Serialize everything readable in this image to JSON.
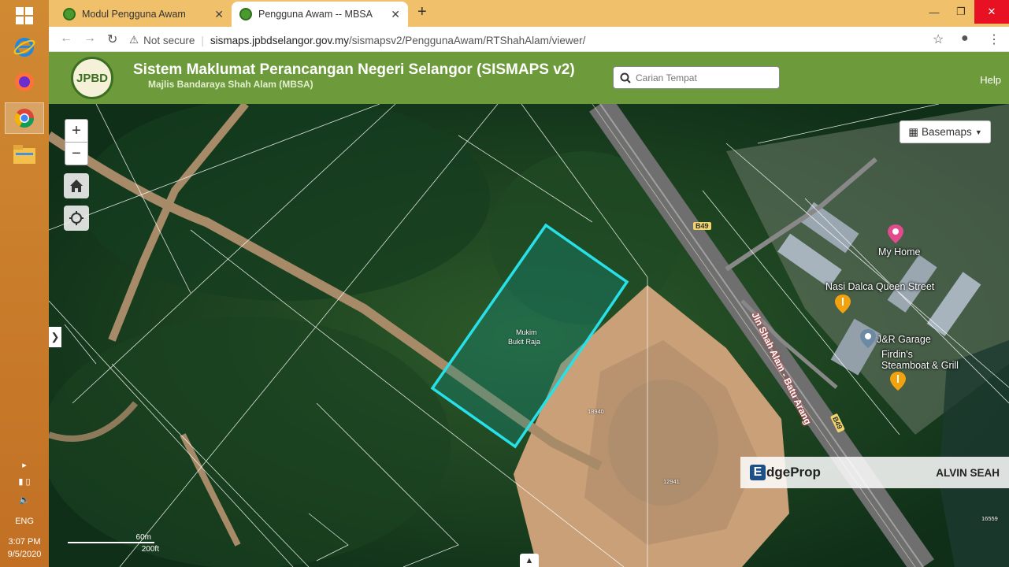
{
  "taskbar": {
    "tray": {
      "language": "ENG",
      "time": "3:07 PM",
      "date": "9/5/2020"
    }
  },
  "browser": {
    "tabs": [
      {
        "label": "Modul Pengguna Awam",
        "active": false
      },
      {
        "label": "Pengguna Awam -- MBSA",
        "active": true
      }
    ],
    "address": {
      "security": "Not secure",
      "host": "sismaps.jpbdselangor.gov.my",
      "path": "/sismapsv2/PenggunaAwam/RTShahAlam/viewer/"
    }
  },
  "app": {
    "logo_text": "JPBD",
    "title": "Sistem Maklumat Perancangan Negeri Selangor (SISMAPS v2)",
    "subtitle": "Majlis Bandaraya Shah Alam (MBSA)",
    "search_placeholder": "Carian Tempat",
    "help_label": "Help"
  },
  "map": {
    "zoom_in": "+",
    "zoom_out": "−",
    "basemaps_label": "Basemaps",
    "parcel_label_1": "Mukim",
    "parcel_label_2": "Bukit Raja",
    "pois": {
      "my_home": "My Home",
      "nasi_dalca": "Nasi Dalca Queen Street",
      "jr_garage": "J&R Garage",
      "firdins_1": "Firdin's",
      "firdins_2": "Steamboat & Grill"
    },
    "road_label": "Jln Shah Alam - Batu Arang",
    "route_shield_1": "B49",
    "route_shield_2": "B49",
    "lot_numbers": {
      "lot1": "18940",
      "lot2": "12941",
      "lot3": "16559"
    },
    "scale_metric": "60m",
    "scale_imperial": "200ft"
  },
  "watermark": {
    "brand_e": "E",
    "brand_rest": "dgeProp",
    "agent": "ALVIN SEAH"
  }
}
